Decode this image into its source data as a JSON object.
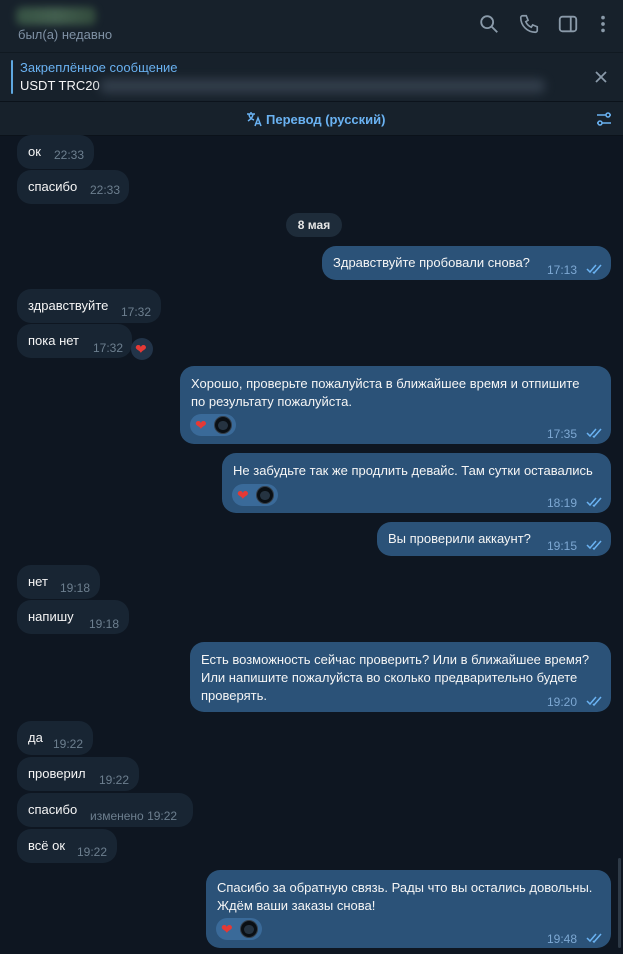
{
  "header": {
    "status": "был(а) недавно"
  },
  "pinned": {
    "title": "Закреплённое сообщение",
    "text": "USDT TRC20"
  },
  "translate": {
    "label": "Перевод (русский)"
  },
  "date_separator": "8 мая",
  "messages": [
    {
      "text": "ок",
      "time": "22:33"
    },
    {
      "text": "спасибо",
      "time": "22:33"
    },
    {
      "text": "Здравствуйте пробовали снова?",
      "time": "17:13"
    },
    {
      "text": "здравствуйте",
      "time": "17:32"
    },
    {
      "text": "пока нет",
      "time": "17:32"
    },
    {
      "line1": "Хорошо, проверьте пожалуйста в ближайшее время и отпишите",
      "line2": "по результату пожалуйста.",
      "time": "17:35"
    },
    {
      "text": "Не забудьте так же продлить девайс. Там сутки оставались",
      "time": "18:19"
    },
    {
      "text": "Вы проверили аккаунт?",
      "time": "19:15"
    },
    {
      "text": "нет",
      "time": "19:18"
    },
    {
      "text": "напишу",
      "time": "19:18"
    },
    {
      "line1": "Есть возможность сейчас проверить? Или в ближайшее время?",
      "line2": "Или напишите пожалуйста во сколько предварительно будете",
      "line3": "проверять.",
      "time": "19:20"
    },
    {
      "text": "да",
      "time": "19:22"
    },
    {
      "text": "проверил",
      "time": "19:22"
    },
    {
      "text": "спасибо",
      "time": "изменено 19:22"
    },
    {
      "text": "всё ок",
      "time": "19:22"
    },
    {
      "line1": "Спасибо за обратную связь. Рады что вы остались довольны.",
      "line2": "Ждём ваши заказы снова!",
      "time": "19:48"
    }
  ],
  "icons": {
    "search": "search-icon",
    "call": "phone-icon",
    "sidebar": "sidebar-icon",
    "more": "more-vertical-icon"
  },
  "colors": {
    "background": "#0e1621",
    "incoming_bubble": "#182533",
    "outgoing_bubble": "#2b5278",
    "accent": "#6ab2f2",
    "heart": "#e53935"
  }
}
